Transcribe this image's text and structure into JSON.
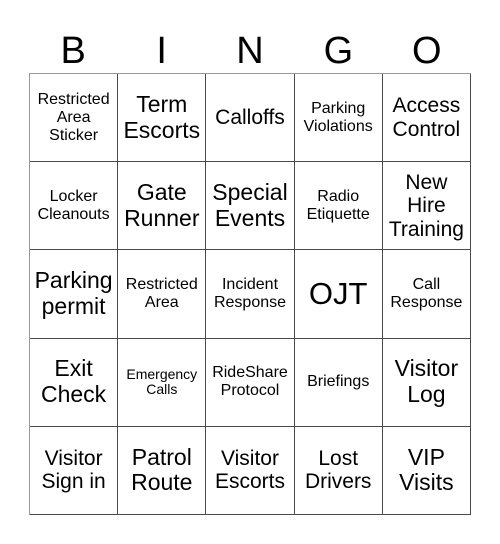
{
  "card": {
    "title": "BINGO",
    "header_letters": [
      "B",
      "I",
      "N",
      "G",
      "O"
    ],
    "rows": 5,
    "columns": 5,
    "border_color": "#4a4a4a",
    "text_color": "#000000",
    "background_color": "#ffffff",
    "cells": [
      {
        "text": "Restricted Area Sticker",
        "size": "sm"
      },
      {
        "text": "Term Escorts",
        "size": "lg"
      },
      {
        "text": "Calloffs",
        "size": "md"
      },
      {
        "text": "Parking Violations",
        "size": "sm"
      },
      {
        "text": "Access Control",
        "size": "md"
      },
      {
        "text": "Locker Cleanouts",
        "size": "sm"
      },
      {
        "text": "Gate Runner",
        "size": "lg"
      },
      {
        "text": "Special Events",
        "size": "lg"
      },
      {
        "text": "Radio Etiquette",
        "size": "sm"
      },
      {
        "text": "New Hire Training",
        "size": "md"
      },
      {
        "text": "Parking permit",
        "size": "lg"
      },
      {
        "text": "Restricted Area",
        "size": "sm"
      },
      {
        "text": "Incident Response",
        "size": "sm"
      },
      {
        "text": "OJT",
        "size": "xl"
      },
      {
        "text": "Call Response",
        "size": "sm"
      },
      {
        "text": "Exit Check",
        "size": "lg"
      },
      {
        "text": "Emergency Calls",
        "size": "xs"
      },
      {
        "text": "RideShare Protocol",
        "size": "sm"
      },
      {
        "text": "Briefings",
        "size": "sm"
      },
      {
        "text": "Visitor Log",
        "size": "lg"
      },
      {
        "text": "Visitor Sign in",
        "size": "md"
      },
      {
        "text": "Patrol Route",
        "size": "lg"
      },
      {
        "text": "Visitor Escorts",
        "size": "md"
      },
      {
        "text": "Lost Drivers",
        "size": "md"
      },
      {
        "text": "VIP Visits",
        "size": "lg"
      }
    ]
  }
}
